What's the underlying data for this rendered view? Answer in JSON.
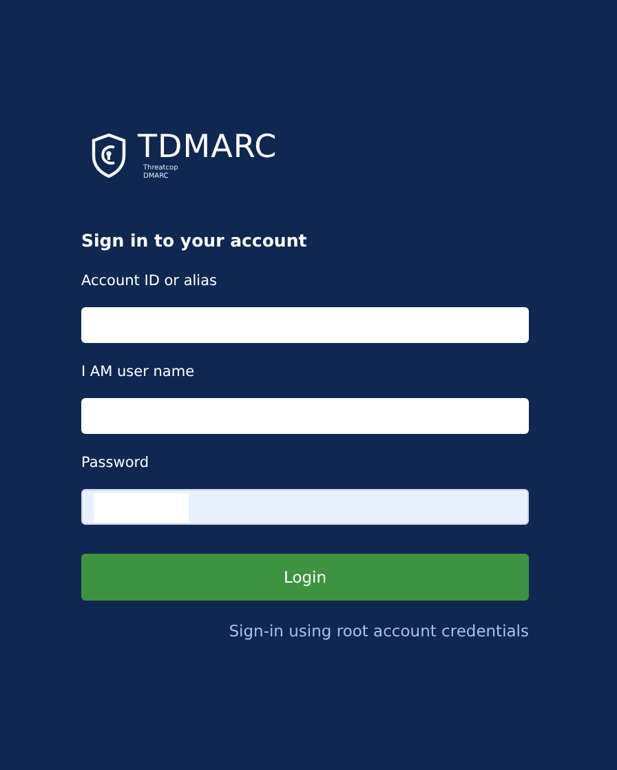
{
  "logo": {
    "name": "TDMARC",
    "tagline_1": "Threatcop",
    "tagline_2": "DMARC"
  },
  "heading": "Sign in to your account",
  "fields": [
    {
      "label": "Account ID or alias",
      "autofilled": false,
      "masked": false
    },
    {
      "label": "I AM user name",
      "autofilled": false,
      "masked": false
    },
    {
      "label": "Password",
      "autofilled": true,
      "masked": true
    }
  ],
  "login_button": "Login",
  "root_link": "Sign-in using root account credentials"
}
